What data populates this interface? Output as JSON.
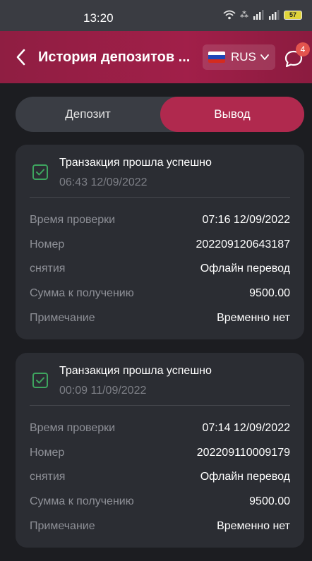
{
  "statusbar": {
    "time": "13:20",
    "battery": "57"
  },
  "header": {
    "title": "История депозитов ...",
    "language": "RUS",
    "notifications": "4"
  },
  "tabs": [
    {
      "label": "Депозит"
    },
    {
      "label": "Вывод"
    }
  ],
  "transactions": [
    {
      "status": "Транзакция прошла успешно",
      "time": "06:43 12/09/2022",
      "rows": [
        {
          "label": "Время проверки",
          "value": "07:16 12/09/2022"
        },
        {
          "label": "Номер",
          "value": "202209120643187"
        },
        {
          "label": "снятия",
          "value": "Офлайн перевод"
        },
        {
          "label": "Сумма к получению",
          "value": "9500.00"
        },
        {
          "label": "Примечание",
          "value": "Временно нет"
        }
      ]
    },
    {
      "status": "Транзакция прошла успешно",
      "time": "00:09 11/09/2022",
      "rows": [
        {
          "label": "Время проверки",
          "value": "07:14 12/09/2022"
        },
        {
          "label": "Номер",
          "value": "202209110009179"
        },
        {
          "label": "снятия",
          "value": "Офлайн перевод"
        },
        {
          "label": "Сумма к получению",
          "value": "9500.00"
        },
        {
          "label": "Примечание",
          "value": "Временно нет"
        }
      ]
    }
  ],
  "colors": {
    "accent": "#b0294e",
    "header": "#a11f49",
    "success": "#3ea55f",
    "badge": "#e3544e"
  },
  "icons": [
    "back-arrow-icon",
    "russia-flag-icon",
    "chevron-down-icon",
    "chat-icon",
    "check-icon",
    "wifi-icon",
    "signal-icon",
    "battery-icon"
  ]
}
